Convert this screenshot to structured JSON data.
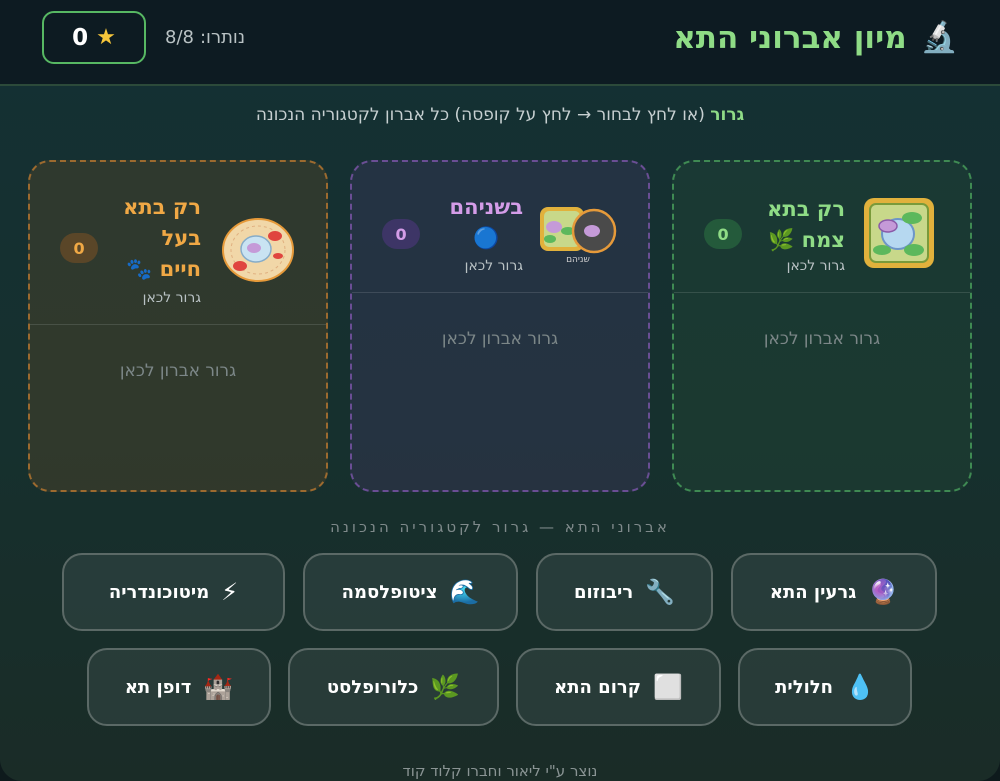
{
  "header": {
    "title": "מיון אברוני התא",
    "title_icon": "microscope-icon",
    "score": "0",
    "remaining_label": "נותרו:",
    "remaining_value": "8/8"
  },
  "instruction": {
    "drag_word": "גרור",
    "rest": "(או לחץ לבחור → לחץ על קופסה) כל אברון לקטגוריה הנכונה"
  },
  "bins": {
    "plant": {
      "title_line1": "רק בתא",
      "title_line2": "צמח 🌿",
      "subtitle": "גרור לכאן",
      "count": "0",
      "drop_hint": "גרור אברון לכאן",
      "color": "#8fdc86"
    },
    "both": {
      "title_line1": "בשניהם",
      "title_line2": "🔵",
      "icon_caption": "שניהם",
      "subtitle": "גרור לכאן",
      "count": "0",
      "drop_hint": "גרור אברון לכאן",
      "color": "#d49ce8"
    },
    "animal": {
      "title_line1": "רק בתא",
      "title_line2": "בעל",
      "title_line3": "חיים 🐾",
      "subtitle": "גרור לכאן",
      "count": "0",
      "drop_hint": "גרור אברון לכאן",
      "color": "#f0a845"
    }
  },
  "organelles_caption": "אברוני התא — גרור לקטגוריה הנכונה",
  "organelles": [
    {
      "label": "גרעין התא",
      "icon": "🔮",
      "icon_name": "crystal-ball-icon"
    },
    {
      "label": "ריבוזום",
      "icon": "🔧",
      "icon_name": "wrench-icon"
    },
    {
      "label": "ציטופלסמה",
      "icon": "🌊",
      "icon_name": "wave-icon"
    },
    {
      "label": "מיטוכונדריה",
      "icon": "⚡",
      "icon_name": "lightning-icon"
    },
    {
      "label": "חלולית",
      "icon": "💧",
      "icon_name": "droplet-icon"
    },
    {
      "label": "קרום התא",
      "icon": "⬜",
      "icon_name": "square-icon"
    },
    {
      "label": "כלורופלסט",
      "icon": "🌿",
      "icon_name": "leaf-icon"
    },
    {
      "label": "דופן תא",
      "icon": "🏰",
      "icon_name": "castle-icon"
    }
  ],
  "footer": "נוצר ע\"י ליאור וחברו קלוד קוד"
}
